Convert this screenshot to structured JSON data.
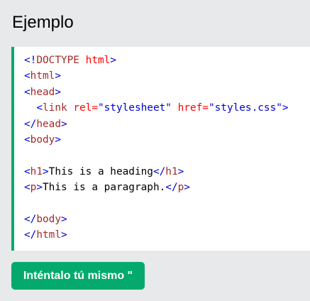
{
  "example_title": "Ejemplo",
  "code_lines": [
    [
      {
        "t": "tb",
        "v": "<!"
      },
      {
        "t": "tn",
        "v": "DOCTYPE"
      },
      {
        "t": "tx",
        "v": " "
      },
      {
        "t": "an",
        "v": "html"
      },
      {
        "t": "tb",
        "v": ">"
      }
    ],
    [
      {
        "t": "tb",
        "v": "<"
      },
      {
        "t": "tn",
        "v": "html"
      },
      {
        "t": "tb",
        "v": ">"
      }
    ],
    [
      {
        "t": "tb",
        "v": "<"
      },
      {
        "t": "tn",
        "v": "head"
      },
      {
        "t": "tb",
        "v": ">"
      }
    ],
    [
      {
        "t": "tx",
        "v": "  "
      },
      {
        "t": "tb",
        "v": "<"
      },
      {
        "t": "tn",
        "v": "link"
      },
      {
        "t": "tx",
        "v": " "
      },
      {
        "t": "an",
        "v": "rel="
      },
      {
        "t": "av",
        "v": "\"stylesheet\""
      },
      {
        "t": "tx",
        "v": " "
      },
      {
        "t": "an",
        "v": "href="
      },
      {
        "t": "av",
        "v": "\"styles.css\""
      },
      {
        "t": "tb",
        "v": ">"
      }
    ],
    [
      {
        "t": "tb",
        "v": "</"
      },
      {
        "t": "tn",
        "v": "head"
      },
      {
        "t": "tb",
        "v": ">"
      }
    ],
    [
      {
        "t": "tb",
        "v": "<"
      },
      {
        "t": "tn",
        "v": "body"
      },
      {
        "t": "tb",
        "v": ">"
      }
    ],
    [],
    [
      {
        "t": "tb",
        "v": "<"
      },
      {
        "t": "tn",
        "v": "h1"
      },
      {
        "t": "tb",
        "v": ">"
      },
      {
        "t": "tx",
        "v": "This is a heading"
      },
      {
        "t": "tb",
        "v": "</"
      },
      {
        "t": "tn",
        "v": "h1"
      },
      {
        "t": "tb",
        "v": ">"
      }
    ],
    [
      {
        "t": "tb",
        "v": "<"
      },
      {
        "t": "tn",
        "v": "p"
      },
      {
        "t": "tb",
        "v": ">"
      },
      {
        "t": "tx",
        "v": "This is a paragraph."
      },
      {
        "t": "tb",
        "v": "</"
      },
      {
        "t": "tn",
        "v": "p"
      },
      {
        "t": "tb",
        "v": ">"
      }
    ],
    [],
    [
      {
        "t": "tb",
        "v": "</"
      },
      {
        "t": "tn",
        "v": "body"
      },
      {
        "t": "tb",
        "v": ">"
      }
    ],
    [
      {
        "t": "tb",
        "v": "</"
      },
      {
        "t": "tn",
        "v": "html"
      },
      {
        "t": "tb",
        "v": ">"
      }
    ]
  ],
  "try_button_label": "Inténtalo tú mismo \"",
  "colors": {
    "accent": "#04aa6d",
    "panel_background": "#e7e9eb",
    "tag_bracket": "#0000cd",
    "tag_name": "#a52a2a",
    "attribute_name": "#ff0000",
    "attribute_value": "#0000cd"
  }
}
